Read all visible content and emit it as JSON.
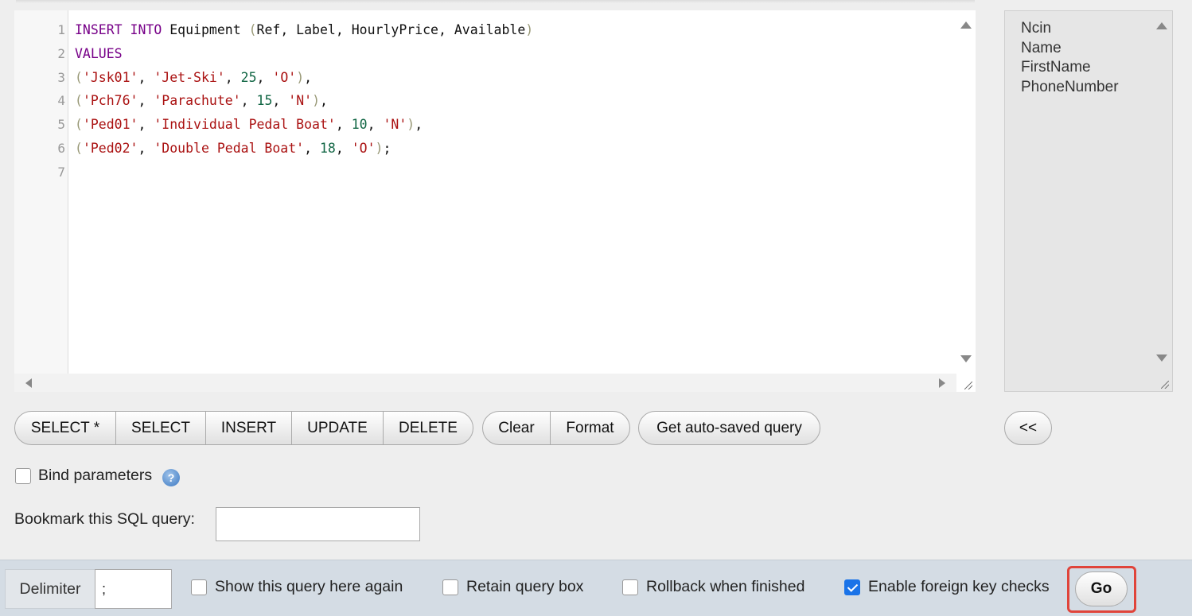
{
  "editor": {
    "line_numbers": [
      "1",
      "2",
      "3",
      "4",
      "5",
      "6",
      "7"
    ],
    "lines": [
      [
        {
          "t": "INSERT",
          "c": "kw"
        },
        {
          "t": " ",
          "c": ""
        },
        {
          "t": "INTO",
          "c": "kw"
        },
        {
          "t": " Equipment ",
          "c": ""
        },
        {
          "t": "(",
          "c": "pun"
        },
        {
          "t": "Ref, Label, HourlyPrice, Available",
          "c": ""
        },
        {
          "t": ")",
          "c": "pun"
        }
      ],
      [
        {
          "t": "VALUES",
          "c": "kw"
        }
      ],
      [
        {
          "t": "(",
          "c": "pun"
        },
        {
          "t": "'Jsk01'",
          "c": "str"
        },
        {
          "t": ", ",
          "c": ""
        },
        {
          "t": "'Jet-Ski'",
          "c": "str"
        },
        {
          "t": ", ",
          "c": ""
        },
        {
          "t": "25",
          "c": "num"
        },
        {
          "t": ", ",
          "c": ""
        },
        {
          "t": "'O'",
          "c": "str"
        },
        {
          "t": ")",
          "c": "pun"
        },
        {
          "t": ",",
          "c": ""
        }
      ],
      [
        {
          "t": "(",
          "c": "pun"
        },
        {
          "t": "'Pch76'",
          "c": "str"
        },
        {
          "t": ", ",
          "c": ""
        },
        {
          "t": "'Parachute'",
          "c": "str"
        },
        {
          "t": ", ",
          "c": ""
        },
        {
          "t": "15",
          "c": "num"
        },
        {
          "t": ", ",
          "c": ""
        },
        {
          "t": "'N'",
          "c": "str"
        },
        {
          "t": ")",
          "c": "pun"
        },
        {
          "t": ",",
          "c": ""
        }
      ],
      [
        {
          "t": "(",
          "c": "pun"
        },
        {
          "t": "'Ped01'",
          "c": "str"
        },
        {
          "t": ", ",
          "c": ""
        },
        {
          "t": "'Individual Pedal Boat'",
          "c": "str"
        },
        {
          "t": ", ",
          "c": ""
        },
        {
          "t": "10",
          "c": "num"
        },
        {
          "t": ", ",
          "c": ""
        },
        {
          "t": "'N'",
          "c": "str"
        },
        {
          "t": ")",
          "c": "pun"
        },
        {
          "t": ",",
          "c": ""
        }
      ],
      [
        {
          "t": "(",
          "c": "pun"
        },
        {
          "t": "'Ped02'",
          "c": "str"
        },
        {
          "t": ", ",
          "c": ""
        },
        {
          "t": "'Double Pedal Boat'",
          "c": "str"
        },
        {
          "t": ", ",
          "c": ""
        },
        {
          "t": "18",
          "c": "num"
        },
        {
          "t": ", ",
          "c": ""
        },
        {
          "t": "'O'",
          "c": "str"
        },
        {
          "t": ")",
          "c": "pun"
        },
        {
          "t": ";",
          "c": ""
        }
      ],
      []
    ]
  },
  "columns": [
    "Ncin",
    "Name",
    "FirstName",
    "PhoneNumber"
  ],
  "query_buttons": [
    "SELECT *",
    "SELECT",
    "INSERT",
    "UPDATE",
    "DELETE"
  ],
  "edit_buttons": [
    "Clear",
    "Format"
  ],
  "autosave_button": "Get auto-saved query",
  "collapse_button": "<<",
  "bind_parameters": {
    "label": "Bind parameters",
    "checked": false,
    "help_icon": "?"
  },
  "bookmark": {
    "label": "Bookmark this SQL query:",
    "value": ""
  },
  "footer": {
    "delimiter_label": "Delimiter",
    "delimiter_value": ";",
    "options": [
      {
        "label": "Show this query here again",
        "checked": false
      },
      {
        "label": "Retain query box",
        "checked": false
      },
      {
        "label": "Rollback when finished",
        "checked": false
      },
      {
        "label": "Enable foreign key checks",
        "checked": true
      }
    ],
    "go_label": "Go"
  },
  "colors": {
    "highlight": "#e0443a",
    "checkbox_checked": "#1a73e8"
  }
}
